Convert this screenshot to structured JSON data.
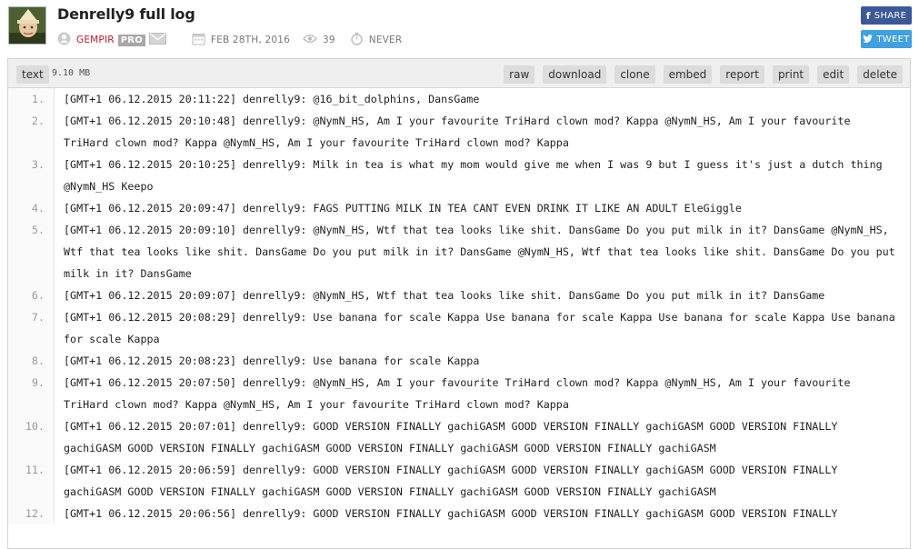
{
  "header": {
    "title": "Denrelly9 full log",
    "user": "GEMPIR",
    "pro_badge": "PRO",
    "date": "FEB 28TH, 2016",
    "views": "39",
    "expires": "NEVER"
  },
  "social": {
    "share_label": "SHARE",
    "tweet_label": "TWEET"
  },
  "toolbar": {
    "format_label": "text",
    "size": "9.10 MB",
    "actions": [
      "raw",
      "download",
      "clone",
      "embed",
      "report",
      "print",
      "edit",
      "delete"
    ]
  },
  "lines": [
    {
      "n": "1.",
      "text": "[GMT+1 06.12.2015 20:11:22] denrelly9: @16_bit_dolphins, DansGame"
    },
    {
      "n": "2.",
      "text": "[GMT+1 06.12.2015 20:10:48] denrelly9: @NymN_HS, Am I your favourite TriHard clown mod? Kappa @NymN_HS, Am I your favourite TriHard clown mod? Kappa @NymN_HS, Am I your favourite TriHard clown mod? Kappa"
    },
    {
      "n": "3.",
      "text": "[GMT+1 06.12.2015 20:10:25] denrelly9: Milk in tea is what my mom would give me when I was 9 but I guess it's just a dutch thing @NymN_HS Keepo"
    },
    {
      "n": "4.",
      "text": "[GMT+1 06.12.2015 20:09:47] denrelly9: FAGS PUTTING MILK IN TEA CANT EVEN DRINK IT LIKE AN ADULT EleGiggle"
    },
    {
      "n": "5.",
      "text": "[GMT+1 06.12.2015 20:09:10] denrelly9: @NymN_HS, Wtf that tea looks like shit. DansGame Do you put milk in it? DansGame @NymN_HS, Wtf that tea looks like shit. DansGame Do you put milk in it? DansGame @NymN_HS, Wtf that tea looks like shit. DansGame Do you put milk in it? DansGame"
    },
    {
      "n": "6.",
      "text": "[GMT+1 06.12.2015 20:09:07] denrelly9: @NymN_HS, Wtf that tea looks like shit. DansGame Do you put milk in it? DansGame"
    },
    {
      "n": "7.",
      "text": "[GMT+1 06.12.2015 20:08:29] denrelly9: Use banana for scale Kappa Use banana for scale Kappa Use banana for scale Kappa Use banana for scale Kappa"
    },
    {
      "n": "8.",
      "text": "[GMT+1 06.12.2015 20:08:23] denrelly9: Use banana for scale Kappa"
    },
    {
      "n": "9.",
      "text": "[GMT+1 06.12.2015 20:07:50] denrelly9: @NymN_HS, Am I your favourite TriHard clown mod? Kappa @NymN_HS, Am I your favourite TriHard clown mod? Kappa @NymN_HS, Am I your favourite TriHard clown mod? Kappa"
    },
    {
      "n": "10.",
      "text": "[GMT+1 06.12.2015 20:07:01] denrelly9: GOOD VERSION FINALLY gachiGASM GOOD VERSION FINALLY gachiGASM GOOD VERSION FINALLY gachiGASM GOOD VERSION FINALLY gachiGASM GOOD VERSION FINALLY gachiGASM GOOD VERSION FINALLY gachiGASM"
    },
    {
      "n": "11.",
      "text": "[GMT+1 06.12.2015 20:06:59] denrelly9: GOOD VERSION FINALLY gachiGASM GOOD VERSION FINALLY gachiGASM GOOD VERSION FINALLY gachiGASM GOOD VERSION FINALLY gachiGASM GOOD VERSION FINALLY gachiGASM GOOD VERSION FINALLY gachiGASM"
    },
    {
      "n": "12.",
      "text": "[GMT+1 06.12.2015 20:06:56] denrelly9: GOOD VERSION FINALLY gachiGASM GOOD VERSION FINALLY gachiGASM GOOD VERSION FINALLY"
    }
  ]
}
